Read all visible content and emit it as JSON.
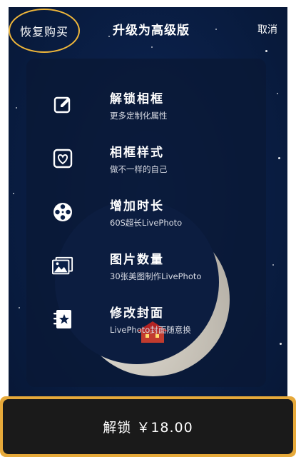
{
  "header": {
    "restore_label": "恢复购买",
    "title": "升级为高级版",
    "cancel_label": "取消"
  },
  "features": [
    {
      "icon": "edit-icon",
      "title": "解锁相框",
      "desc": "更多定制化属性"
    },
    {
      "icon": "heart-frame-icon",
      "title": "相框样式",
      "desc": "做不一样的自己"
    },
    {
      "icon": "film-reel-icon",
      "title": "增加时长",
      "desc": "60S超长LivePhoto"
    },
    {
      "icon": "images-icon",
      "title": "图片数量",
      "desc": "30张美图制作LivePhoto"
    },
    {
      "icon": "notebook-star-icon",
      "title": "修改封面",
      "desc": "LivePhoto封面随意换"
    }
  ],
  "purchase": {
    "button_label": "解锁 ￥18.00"
  },
  "colors": {
    "background": "#0a1f47",
    "highlight": "#f0b73a",
    "button": "#1a1a1a"
  }
}
